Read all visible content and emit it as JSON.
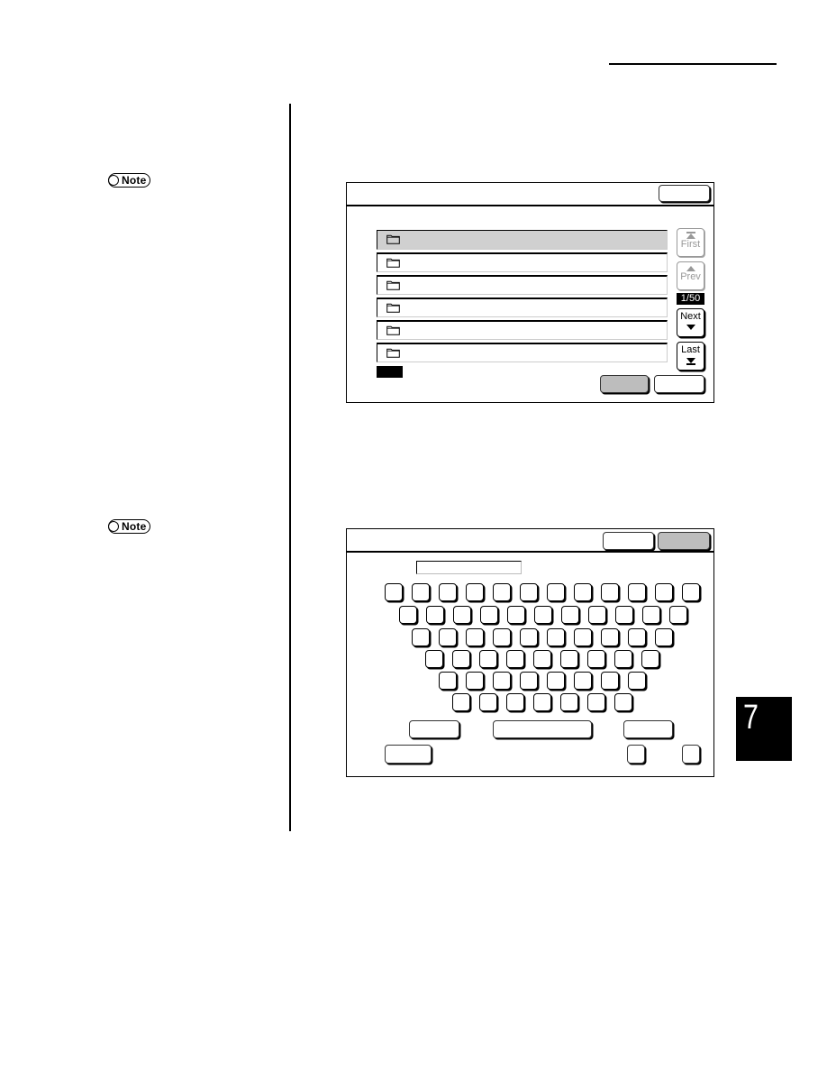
{
  "page": {
    "chapter_number": "7",
    "notes": [
      {
        "label": "Note"
      },
      {
        "label": "Note"
      }
    ]
  },
  "folder_screen": {
    "title": "",
    "close_button": "",
    "folders": [
      {
        "name": "",
        "selected": true,
        "icon": "folder-icon"
      },
      {
        "name": "",
        "selected": false,
        "icon": "folder-icon"
      },
      {
        "name": "",
        "selected": false,
        "icon": "folder-icon"
      },
      {
        "name": "",
        "selected": false,
        "icon": "folder-icon"
      },
      {
        "name": "",
        "selected": false,
        "icon": "folder-icon"
      },
      {
        "name": "",
        "selected": false,
        "icon": "folder-icon"
      }
    ],
    "nav": {
      "first_label": "First",
      "prev_label": "Prev",
      "next_label": "Next",
      "last_label": "Last",
      "page_indicator": "1/50",
      "first_enabled": false,
      "prev_enabled": false,
      "next_enabled": true,
      "last_enabled": true
    },
    "footer_buttons": [
      {
        "label": "",
        "style": "gray"
      },
      {
        "label": "",
        "style": "white"
      }
    ]
  },
  "keyboard_screen": {
    "title": "",
    "header_buttons": [
      {
        "label": "",
        "style": "white"
      },
      {
        "label": "",
        "style": "gray"
      }
    ],
    "input_value": "",
    "key_rows": [
      12,
      11,
      10,
      9,
      8,
      7
    ],
    "function_keys": [
      {
        "label": ""
      },
      {
        "label": ""
      },
      {
        "label": ""
      },
      {
        "label": ""
      },
      {
        "label": ""
      },
      {
        "label": ""
      }
    ]
  }
}
